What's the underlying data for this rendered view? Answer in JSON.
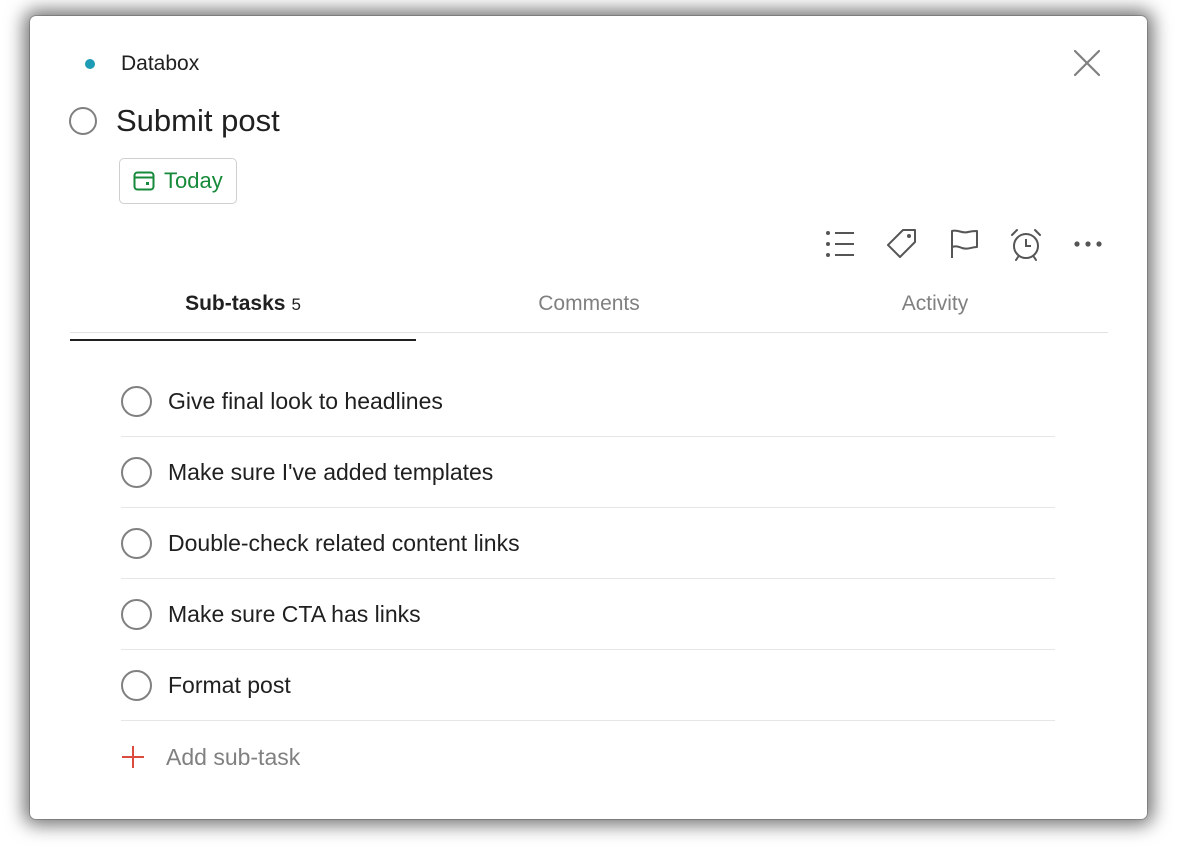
{
  "project": {
    "name": "Databox",
    "color": "#1e9bb5"
  },
  "task": {
    "title": "Submit post"
  },
  "due": {
    "label": "Today",
    "color": "#168a3a"
  },
  "toolbar": {
    "icons": [
      "list-icon",
      "tag-icon",
      "flag-icon",
      "alarm-icon",
      "more-icon"
    ]
  },
  "tabs": [
    {
      "label": "Sub-tasks",
      "count": "5",
      "active": true
    },
    {
      "label": "Comments",
      "active": false
    },
    {
      "label": "Activity",
      "active": false
    }
  ],
  "subtasks": [
    {
      "label": "Give final look to headlines"
    },
    {
      "label": "Make sure I've added templates"
    },
    {
      "label": "Double-check related content links"
    },
    {
      "label": "Make sure CTA has links"
    },
    {
      "label": "Format post"
    }
  ],
  "add_subtask": {
    "label": "Add sub-task",
    "icon_color": "#db4c3f"
  },
  "colors": {
    "text": "#202020",
    "muted": "#808080",
    "divider": "#e6e6e6"
  }
}
